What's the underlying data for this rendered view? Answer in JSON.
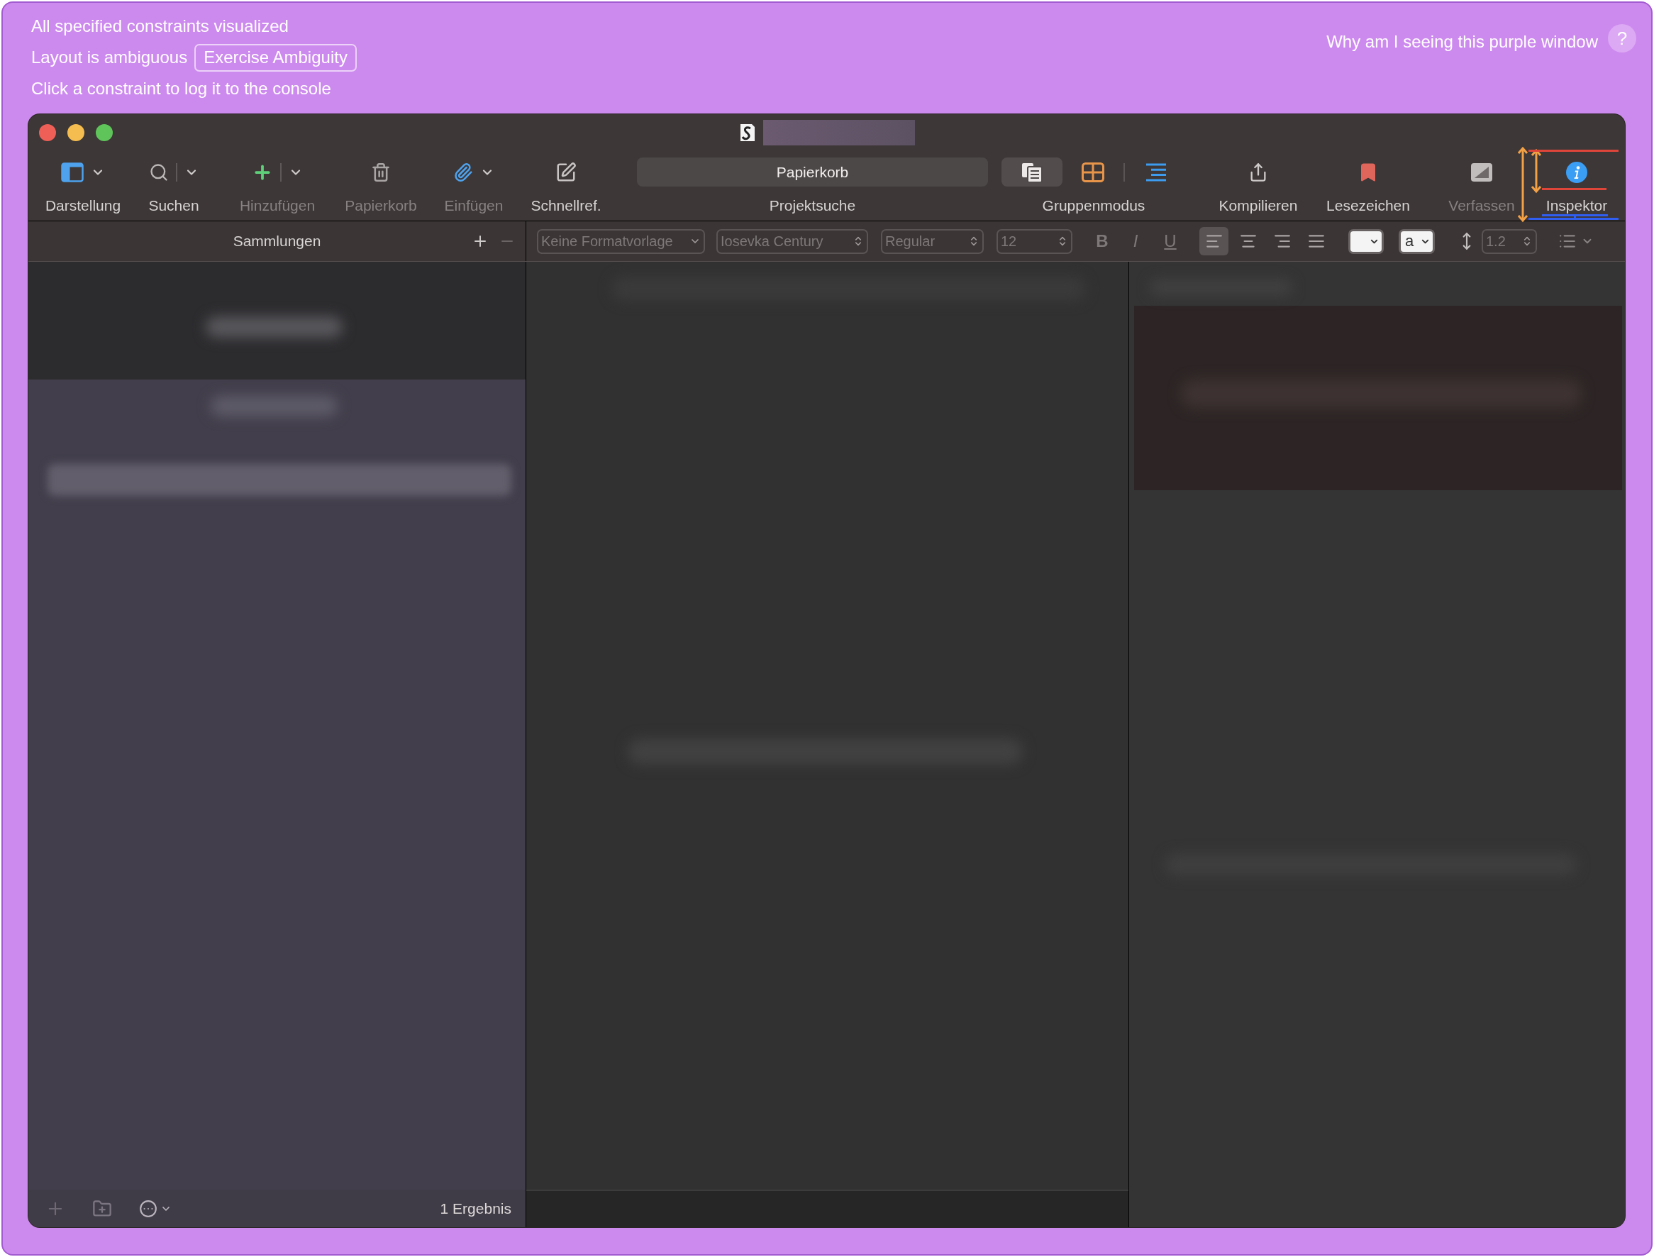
{
  "debug_overlay": {
    "lines": [
      {
        "text": "All specified constraints visualized"
      },
      {
        "text": "Layout is ambiguous",
        "button": "Exercise Ambiguity"
      },
      {
        "text": "Click a constraint to log it to the console"
      }
    ],
    "help_text": "Why am I seeing this purple window",
    "help_button": "?"
  },
  "toolbar": {
    "items": [
      {
        "kind": "button",
        "label": "Darstellung",
        "disabled": false,
        "menu": true,
        "split": false
      },
      {
        "kind": "button",
        "label": "Suchen",
        "disabled": false,
        "menu": true,
        "split": true
      },
      {
        "kind": "button",
        "label": "Hinzufügen",
        "disabled": true,
        "menu": true,
        "split": true
      },
      {
        "kind": "button",
        "label": "Papierkorb",
        "disabled": true,
        "menu": false,
        "split": false
      },
      {
        "kind": "button",
        "label": "Einfügen",
        "disabled": true,
        "menu": true,
        "split": false
      },
      {
        "kind": "button",
        "label": "Schnellref.",
        "disabled": false,
        "menu": false,
        "split": false
      },
      {
        "kind": "search",
        "label": "Projektsuche",
        "value": "Papierkorb"
      },
      {
        "kind": "segmented",
        "label": "Gruppenmodus",
        "segments": [
          {
            "selected": true
          },
          {
            "selected": false
          },
          {
            "selected": false
          }
        ]
      },
      {
        "kind": "button",
        "label": "Kompilieren",
        "disabled": false,
        "menu": false,
        "split": false
      },
      {
        "kind": "button",
        "label": "Lesezeichen",
        "disabled": false,
        "menu": false,
        "split": false
      },
      {
        "kind": "button",
        "label": "Verfassen",
        "disabled": true,
        "menu": false,
        "split": false
      },
      {
        "kind": "button",
        "label": "Inspektor",
        "disabled": false,
        "menu": false,
        "split": false
      }
    ]
  },
  "sidebar": {
    "title": "Sammlungen",
    "header_buttons": [
      {
        "kind": "add",
        "disabled": false
      },
      {
        "kind": "remove",
        "disabled": true
      }
    ],
    "result_count": "1 Ergebnis"
  },
  "format_bar": {
    "disabled": true,
    "style": "Keine Formatvorlage",
    "font": "Iosevka Century",
    "weight": "Regular",
    "size": "12",
    "text_styles": [
      {
        "kind": "bold",
        "label": "B"
      },
      {
        "kind": "italic",
        "label": "I"
      },
      {
        "kind": "underline",
        "label": "U"
      }
    ],
    "alignments": [
      {
        "selected": true
      },
      {
        "selected": false
      },
      {
        "selected": false
      },
      {
        "selected": false
      }
    ],
    "highlight_label": "a",
    "line_spacing": "1.2"
  }
}
